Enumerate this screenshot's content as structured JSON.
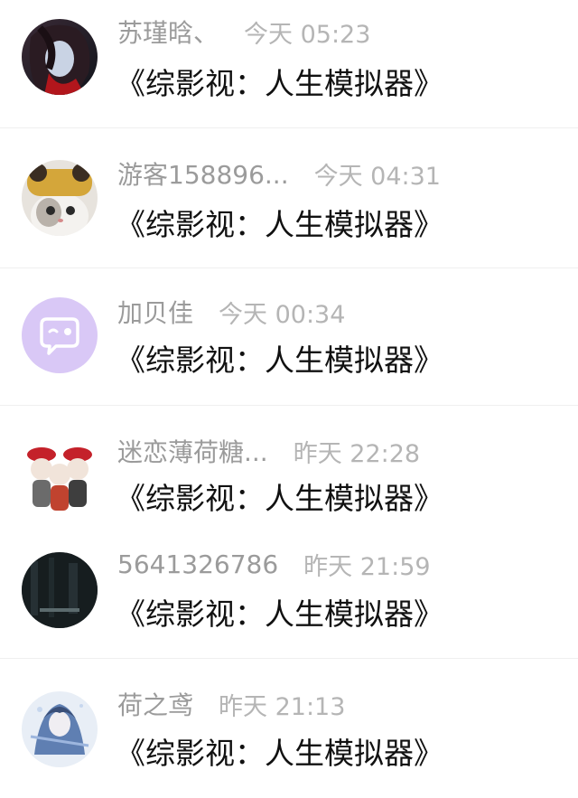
{
  "messages": [
    {
      "name": "苏瑾晗、",
      "time": "今天 05:23",
      "text": "《综影视：人生模拟器》",
      "avatar": "anime-character-avatar"
    },
    {
      "name": "游客158896...",
      "time": "今天 04:31",
      "text": "《综影视：人生模拟器》",
      "avatar": "cat-hat-avatar"
    },
    {
      "name": "加贝佳",
      "time": "今天 00:34",
      "text": "《综影视：人生模拟器》",
      "avatar": "default-chat-avatar"
    },
    {
      "name": "迷恋薄荷糖...",
      "time": "昨天 22:28",
      "text": "《综影视：人生模拟器》",
      "avatar": "chibi-group-avatar"
    },
    {
      "name": "5641326786",
      "time": "昨天 21:59",
      "text": "《综影视：人生模拟器》",
      "avatar": "dark-photo-avatar"
    },
    {
      "name": "荷之鸢",
      "time": "昨天 21:13",
      "text": "《综影视：人生模拟器》",
      "avatar": "anime-illustration-avatar"
    }
  ],
  "colors": {
    "name": "#9b9b9b",
    "time": "#b5b5b5",
    "message": "#111111",
    "default_avatar_bg": "#d9c8f6",
    "divider": "#efefef"
  }
}
